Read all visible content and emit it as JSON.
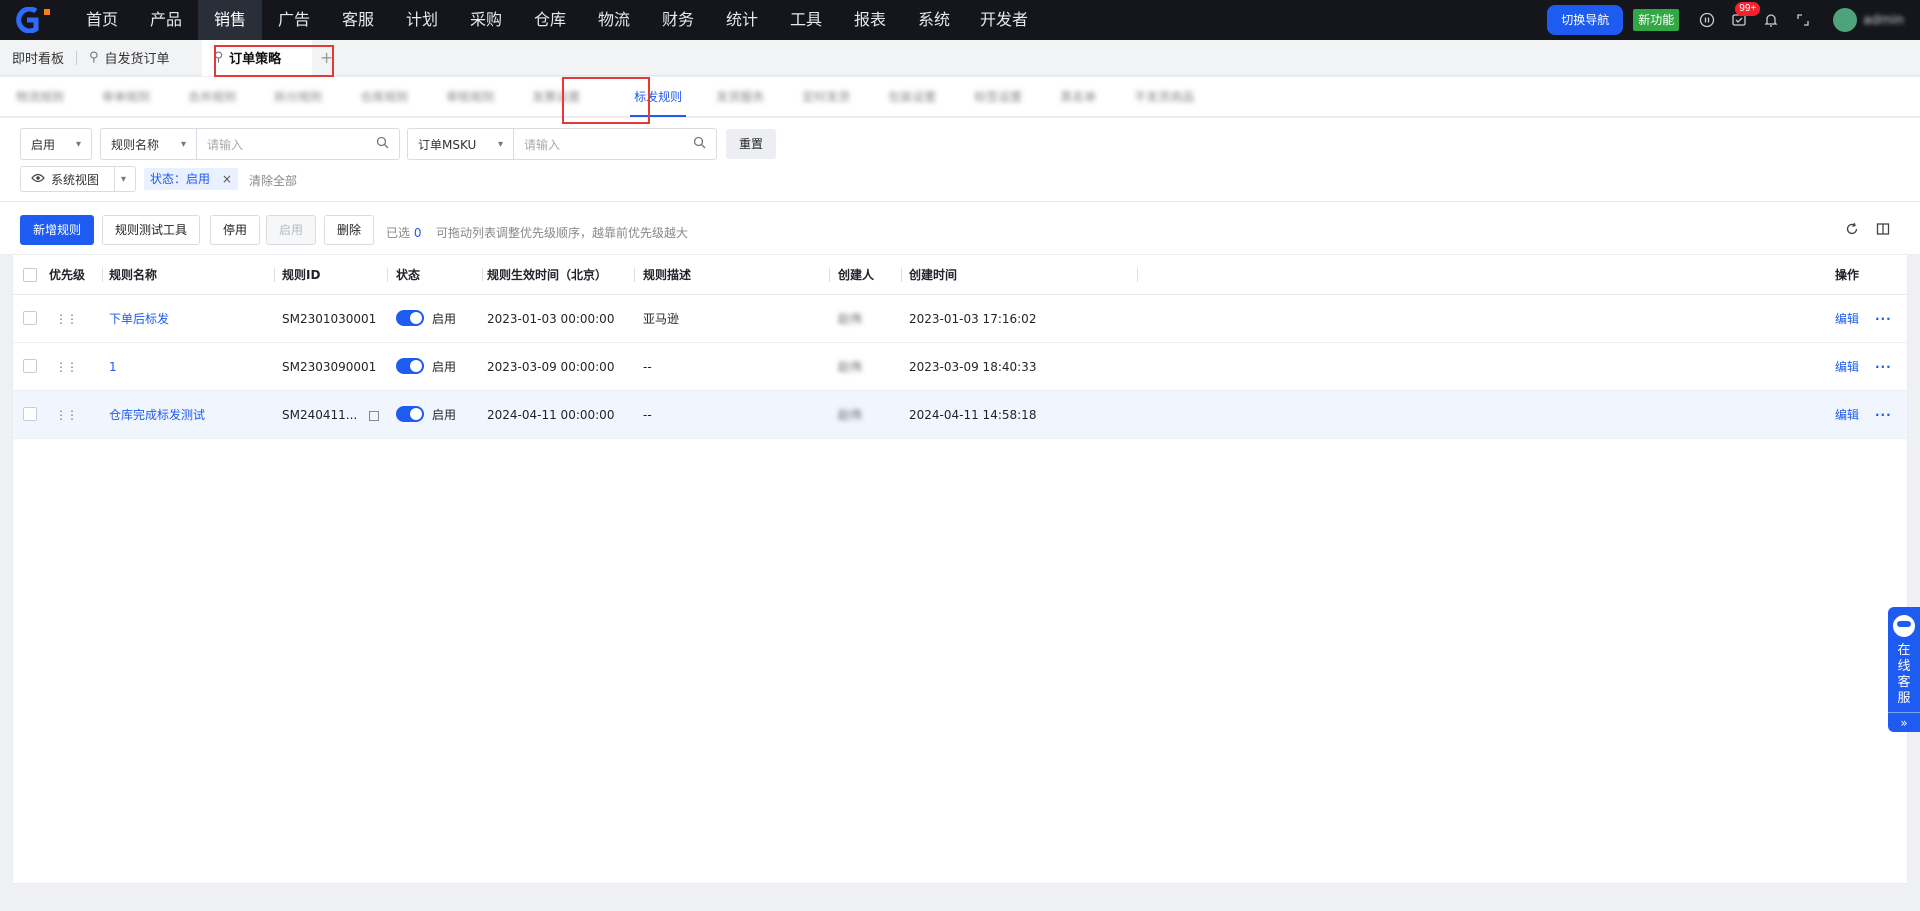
{
  "topnav": {
    "menu": [
      "首页",
      "产品",
      "销售",
      "广告",
      "客服",
      "计划",
      "采购",
      "仓库",
      "物流",
      "财务",
      "统计",
      "工具",
      "报表",
      "系统",
      "开发者"
    ],
    "active_index": 2,
    "switch_nav": "切换导航",
    "new_feature": "新功能",
    "badge": "99+",
    "user": "admin"
  },
  "pagetabs": {
    "items": [
      "即时看板",
      "自发货订单",
      "订单策略"
    ],
    "add": "+"
  },
  "subtabs": {
    "blurred": [
      "物流规则",
      "审单规则",
      "合并规则",
      "拆分规则",
      "仓库规则",
      "审核规则",
      "发票设置"
    ],
    "active": "标发规则",
    "blurred_after": [
      "发货服务",
      "定时发货",
      "包装设置",
      "标签设置",
      "黑名单",
      "不发货商品"
    ]
  },
  "filters": {
    "status_select": "启用",
    "field1_select": "规则名称",
    "field1_placeholder": "请输入",
    "field2_select": "订单MSKU",
    "field2_placeholder": "请输入",
    "reset": "重置",
    "view_label": "系统视图",
    "chip_label": "状态：启用",
    "clear_all": "清除全部"
  },
  "toolbar": {
    "add_rule": "新增规则",
    "test_tool": "规则测试工具",
    "disable": "停用",
    "enable": "启用",
    "delete": "删除",
    "selected_label": "已选",
    "selected_count": "0",
    "hint": "可拖动列表调整优先级顺序，越靠前优先级越大"
  },
  "table": {
    "headers": {
      "priority": "优先级",
      "name": "规则名称",
      "id": "规则ID",
      "status": "状态",
      "effective_time": "规则生效时间（北京）",
      "desc": "规则描述",
      "creator": "创建人",
      "created_at": "创建时间",
      "actions": "操作"
    },
    "rows": [
      {
        "name": "下单后标发",
        "id": "SM2301030001",
        "status": "启用",
        "effective_time": "2023-01-03 00:00:00",
        "desc": "亚马逊",
        "creator": "赵伟",
        "created_at": "2023-01-03 17:16:02",
        "edit": "编辑",
        "more": "···"
      },
      {
        "name": "1",
        "id": "SM2303090001",
        "status": "启用",
        "effective_time": "2023-03-09 00:00:00",
        "desc": "--",
        "creator": "赵伟",
        "created_at": "2023-03-09 18:40:33",
        "edit": "编辑",
        "more": "···"
      },
      {
        "name": "仓库完成标发测试",
        "id": "SM240411...",
        "status": "启用",
        "effective_time": "2024-04-11 00:00:00",
        "desc": "--",
        "creator": "赵伟",
        "created_at": "2024-04-11 14:58:18",
        "edit": "编辑",
        "more": "···"
      }
    ]
  },
  "service": {
    "label": "在线客服",
    "arrow": "»"
  },
  "colors": {
    "primary": "#1e5bf0",
    "nav_bg": "#14161c",
    "new_feature": "#32a845",
    "highlight": "#e53935"
  }
}
